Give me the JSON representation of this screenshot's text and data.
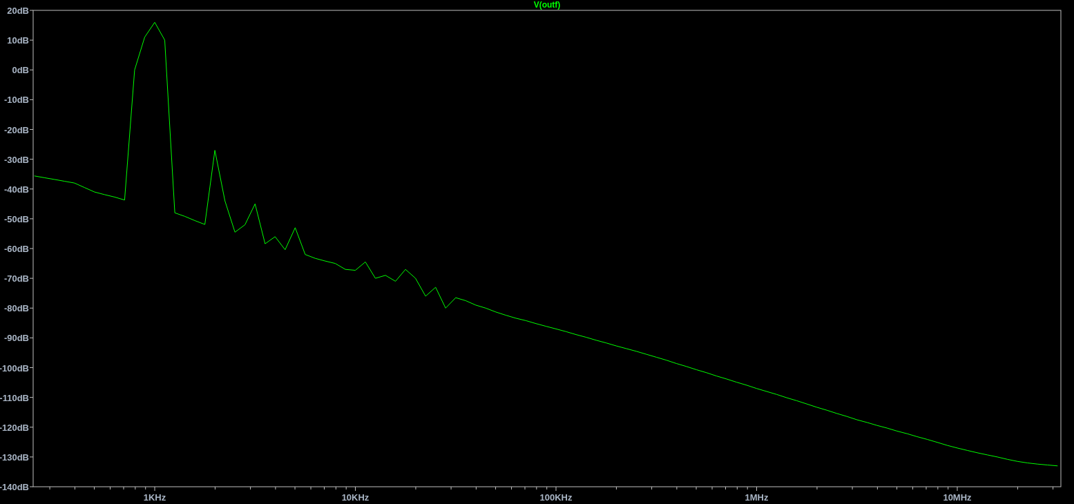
{
  "plot": {
    "chart_data": {
      "type": "line",
      "ylim": [
        -140,
        20
      ],
      "yticks": [
        {
          "value": 20,
          "label": "20dB"
        },
        {
          "value": 10,
          "label": "10dB"
        },
        {
          "value": 0,
          "label": "0dB"
        },
        {
          "value": -10,
          "label": "-10dB"
        },
        {
          "value": -20,
          "label": "-20dB"
        },
        {
          "value": -30,
          "label": "-30dB"
        },
        {
          "value": -40,
          "label": "-40dB"
        },
        {
          "value": -50,
          "label": "-50dB"
        },
        {
          "value": -60,
          "label": "-60dB"
        },
        {
          "value": -70,
          "label": "-70dB"
        },
        {
          "value": -80,
          "label": "-80dB"
        },
        {
          "value": -90,
          "label": "-90dB"
        },
        {
          "value": -100,
          "label": "-100dB"
        },
        {
          "value": -110,
          "label": "-110dB"
        },
        {
          "value": -120,
          "label": "-120dB"
        },
        {
          "value": -130,
          "label": "-130dB"
        },
        {
          "value": -140,
          "label": "-140dB"
        }
      ],
      "categories": [
        null,
        null,
        null,
        null,
        null,
        null,
        null,
        null,
        null,
        null,
        null,
        null,
        "1KHz",
        null,
        null,
        null,
        null,
        null,
        null,
        null,
        null,
        null,
        null,
        null,
        null,
        null,
        null,
        null,
        null,
        null,
        null,
        null,
        "10KHz",
        null,
        null,
        null,
        null,
        null,
        null,
        null,
        null,
        null,
        null,
        null,
        null,
        null,
        null,
        null,
        null,
        null,
        null,
        null,
        "100KHz",
        null,
        null,
        null,
        null,
        null,
        null,
        null,
        null,
        null,
        null,
        null,
        null,
        null,
        null,
        null,
        null,
        null,
        null,
        null,
        "1MHz",
        null,
        null,
        null,
        null,
        null,
        null,
        null,
        null,
        null,
        null,
        null,
        null,
        null,
        null,
        null,
        null,
        null,
        null,
        null,
        "10MHz",
        null,
        null,
        null,
        null,
        null,
        null,
        null,
        null,
        null,
        null
      ],
      "series": [
        {
          "name": "V(outf)",
          "color": "#00ff00",
          "values": [
            -35.6,
            -36.2,
            -36.8,
            -37.4,
            -38,
            -39.5,
            -41,
            -41.9,
            -42.7,
            -43.7,
            0,
            11,
            16,
            10,
            -48,
            -49.2,
            -50.6,
            -51.9,
            -27,
            -44,
            -54.5,
            -52,
            -45,
            -58.4,
            -56,
            -60.4,
            -53,
            -62,
            -63.3,
            -64.2,
            -65,
            -67,
            -67.3,
            -64.5,
            -70,
            -69,
            -71,
            -67,
            -70,
            -76,
            -73,
            -80,
            -76.5,
            -77.5,
            -79,
            -80,
            -81.3,
            -82.4,
            -83.4,
            -84.2,
            -85.2,
            -86.1,
            -87,
            -87.9,
            -88.9,
            -89.8,
            -90.8,
            -91.7,
            -92.7,
            -93.6,
            -94.5,
            -95.5,
            -96.5,
            -97.5,
            -98.6,
            -99.6,
            -100.7,
            -101.7,
            -102.8,
            -103.8,
            -104.9,
            -105.9,
            -107,
            -108,
            -109,
            -110.1,
            -111.1,
            -112.2,
            -113.3,
            -114.3,
            -115.4,
            -116.4,
            -117.5,
            -118.4,
            -119.4,
            -120.3,
            -121.3,
            -122.2,
            -123.2,
            -124.1,
            -125.1,
            -126.1,
            -127,
            -127.8,
            -128.6,
            -129.3,
            -130,
            -130.8,
            -131.5,
            -132,
            -132.4,
            -132.7,
            -133
          ]
        }
      ]
    }
  }
}
